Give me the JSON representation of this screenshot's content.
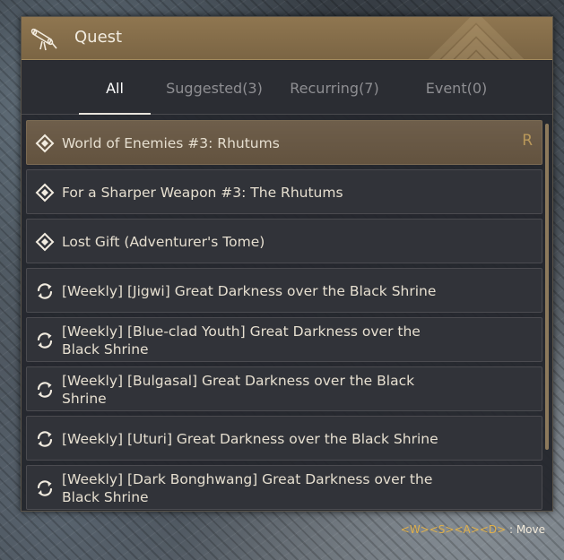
{
  "window": {
    "title": "Quest",
    "title_icon": "scroll-icon"
  },
  "tabs": [
    {
      "label": "All",
      "active": true
    },
    {
      "label": "Suggested(3)",
      "active": false
    },
    {
      "label": "Recurring(7)",
      "active": false
    },
    {
      "label": "Event(0)",
      "active": false
    }
  ],
  "quests": [
    {
      "label": "World of Enemies #3: Rhutums",
      "icon": "quest-diamond-icon",
      "badge": "R",
      "selected": true
    },
    {
      "label": "For a Sharper Weapon #3: The Rhutums",
      "icon": "quest-diamond-icon",
      "badge": "",
      "selected": false
    },
    {
      "label": "Lost Gift (Adventurer's Tome)",
      "icon": "quest-diamond-icon",
      "badge": "",
      "selected": false
    },
    {
      "label": "[Weekly] [Jigwi] Great Darkness over the Black Shrine",
      "icon": "recurring-icon",
      "badge": "",
      "selected": false
    },
    {
      "label": "[Weekly] [Blue-clad Youth] Great Darkness over the Black Shrine",
      "icon": "recurring-icon",
      "badge": "",
      "selected": false
    },
    {
      "label": "[Weekly] [Bulgasal] Great Darkness over the Black Shrine",
      "icon": "recurring-icon",
      "badge": "",
      "selected": false
    },
    {
      "label": "[Weekly] [Uturi] Great Darkness over the Black Shrine",
      "icon": "recurring-icon",
      "badge": "",
      "selected": false
    },
    {
      "label": "[Weekly] [Dark Bonghwang] Great Darkness over the Black Shrine",
      "icon": "recurring-icon",
      "badge": "",
      "selected": false
    }
  ],
  "footer": {
    "keys": "<W><S><A><D>",
    "action": " : Move"
  },
  "colors": {
    "title_bar": "#8a7250",
    "selected_row": "#6a5a47",
    "badge": "#b9985a",
    "key_hint": "#e0b04a"
  }
}
